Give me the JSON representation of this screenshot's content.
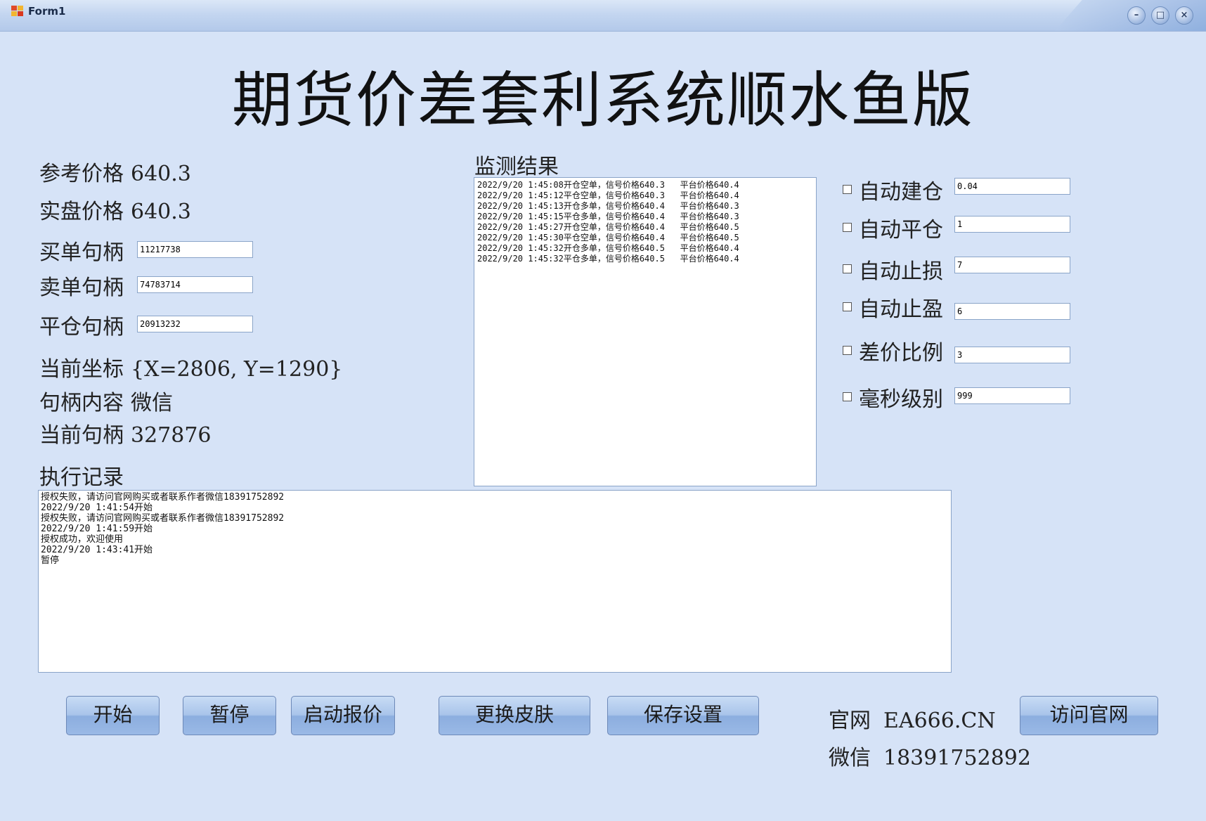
{
  "window": {
    "title": "Form1"
  },
  "header": {
    "title": "期货价差套利系统顺水鱼版"
  },
  "left": {
    "ref_price_label": "参考价格",
    "ref_price_value": "640.3",
    "real_price_label": "实盘价格",
    "real_price_value": "640.3",
    "buy_handle_label": "买单句柄",
    "buy_handle_value": "11217738",
    "sell_handle_label": "卖单句柄",
    "sell_handle_value": "74783714",
    "close_handle_label": "平仓句柄",
    "close_handle_value": "20913232",
    "coord_label": "当前坐标",
    "coord_value": "{X=2806, Y=1290}",
    "content_label": "句柄内容",
    "content_value": "微信",
    "current_handle_label": "当前句柄",
    "current_handle_value": "327876"
  },
  "monitor": {
    "title": "监测结果",
    "lines": [
      "2022/9/20 1:45:08开仓空单，信号价格640.3   平台价格640.4",
      "2022/9/20 1:45:12平仓空单，信号价格640.3   平台价格640.4",
      "2022/9/20 1:45:13开仓多单，信号价格640.4   平台价格640.3",
      "2022/9/20 1:45:15平仓多单，信号价格640.4   平台价格640.3",
      "2022/9/20 1:45:27开仓空单，信号价格640.4   平台价格640.5",
      "2022/9/20 1:45:30平仓空单，信号价格640.4   平台价格640.5",
      "2022/9/20 1:45:32开仓多单，信号价格640.5   平台价格640.4",
      "2022/9/20 1:45:32平仓多单，信号价格640.5   平台价格640.4"
    ]
  },
  "settings": {
    "auto_open_label": "自动建仓",
    "auto_open_value": "0.04",
    "auto_close_label": "自动平仓",
    "auto_close_value": "1",
    "stop_loss_label": "自动止损",
    "stop_loss_value": "7",
    "take_profit_label": "自动止盈",
    "take_profit_value": "6",
    "spread_ratio_label": "差价比例",
    "spread_ratio_value": "3",
    "ms_level_label": "毫秒级别",
    "ms_level_value": "999"
  },
  "log": {
    "title": "执行记录",
    "lines": [
      "授权失败，请访问官网购买或者联系作者微信18391752892",
      "2022/9/20 1:41:54开始",
      "授权失败，请访问官网购买或者联系作者微信18391752892",
      "2022/9/20 1:41:59开始",
      "授权成功，欢迎使用",
      "2022/9/20 1:43:41开始",
      "暂停"
    ]
  },
  "buttons": {
    "start": "开始",
    "pause": "暂停",
    "quote": "启动报价",
    "skin": "更换皮肤",
    "save": "保存设置",
    "visit": "访问官网"
  },
  "contact": {
    "site_label": "官网",
    "site_value": "EA666.CN",
    "wechat_label": "微信",
    "wechat_value": "18391752892"
  }
}
